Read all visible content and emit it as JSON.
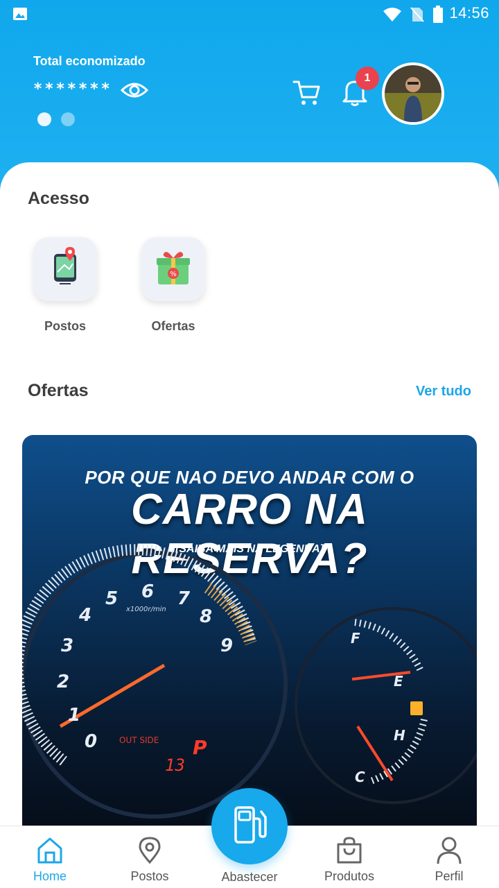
{
  "status_bar": {
    "time": "14:56"
  },
  "header": {
    "total_label": "Total economizado",
    "total_value": "*******",
    "notification_count": "1"
  },
  "access": {
    "title": "Acesso",
    "items": [
      {
        "label": "Postos"
      },
      {
        "label": "Ofertas"
      }
    ]
  },
  "offers": {
    "title": "Ofertas",
    "see_all": "Ver tudo",
    "banner": {
      "line1": "POR QUE NAO DEVO ANDAR COM O",
      "line2": "CARRO NA RESERVA?",
      "line3": "[SAIBA MAIS NA LEGENDA]",
      "gauge_numbers": [
        "0",
        "1",
        "2",
        "3",
        "4",
        "5",
        "6",
        "7",
        "8",
        "9"
      ],
      "rpm_label": "x1000r/min",
      "outside_label": "OUT SIDE",
      "temp": "13",
      "gear": "P",
      "fuel_labels": [
        "F",
        "E",
        "H",
        "C"
      ]
    }
  },
  "bottom_nav": {
    "items": [
      {
        "label": "Home"
      },
      {
        "label": "Postos"
      },
      {
        "label": "Abastecer"
      },
      {
        "label": "Produtos"
      },
      {
        "label": "Perfil"
      }
    ]
  },
  "colors": {
    "header_blue": "#10a7ec",
    "accent": "#1ba7e7",
    "badge_red": "#e9434f"
  }
}
